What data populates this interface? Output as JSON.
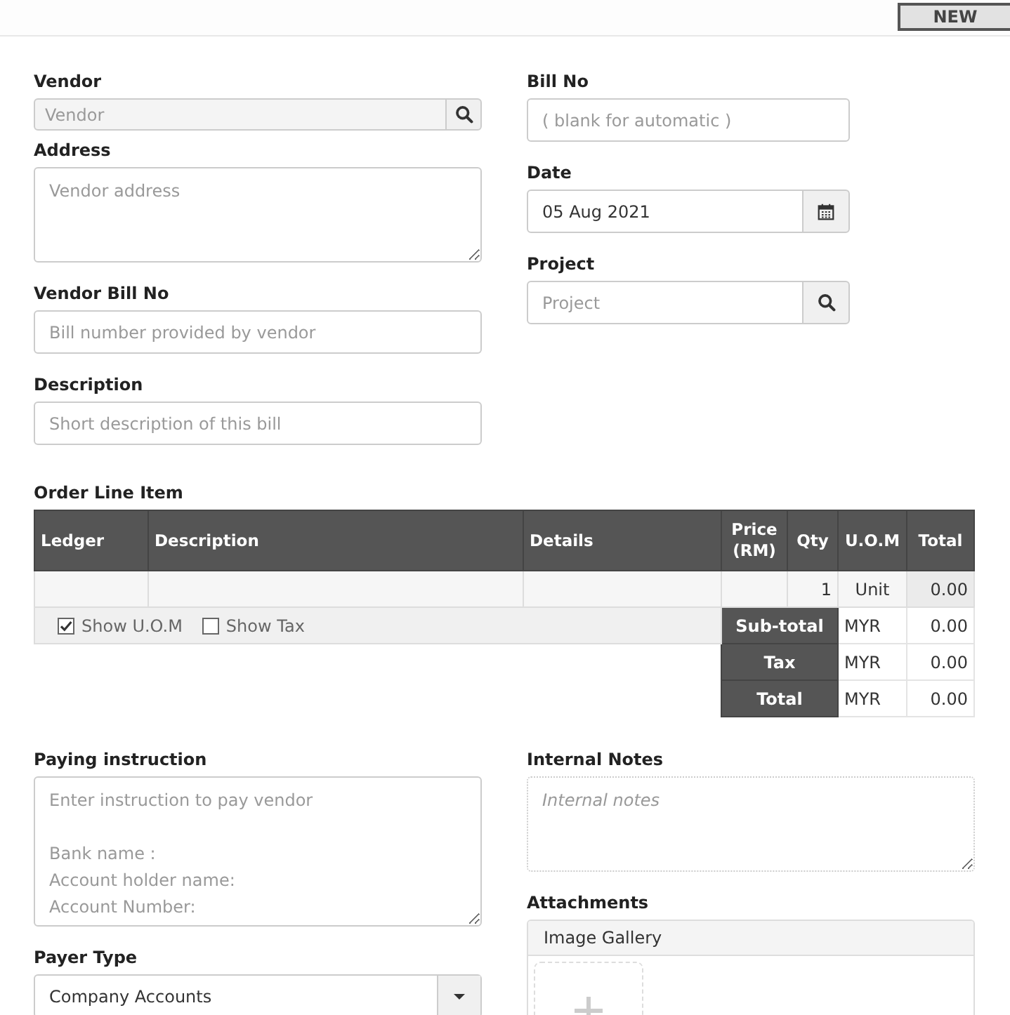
{
  "toolbar": {
    "new_button": "NEW"
  },
  "left_fields": [
    {
      "kind": "search",
      "label": "Vendor",
      "placeholder": "Vendor",
      "readonly": true
    },
    {
      "kind": "textarea",
      "label": "Address",
      "placeholder": "Vendor address"
    },
    {
      "kind": "text",
      "label": "Vendor Bill No",
      "placeholder": "Bill number provided by vendor"
    },
    {
      "kind": "text",
      "label": "Description",
      "placeholder": "Short description of this bill"
    }
  ],
  "right_fields": [
    {
      "kind": "text",
      "label": "Bill No",
      "placeholder": "( blank for automatic )"
    },
    {
      "kind": "date",
      "label": "Date",
      "value": "05 Aug 2021"
    },
    {
      "kind": "search",
      "label": "Project",
      "placeholder": "Project",
      "readonly": false
    }
  ],
  "order_lines": {
    "title": "Order Line Item",
    "columns": [
      "Ledger",
      "Description",
      "Details",
      "Price (RM)",
      "Qty",
      "U.O.M",
      "Total"
    ],
    "rows": [
      {
        "qty": "1",
        "uom": "Unit",
        "total": "0.00"
      }
    ],
    "options": [
      {
        "label": "Show U.O.M",
        "checked": true
      },
      {
        "label": "Show Tax",
        "checked": false
      }
    ],
    "totals": [
      {
        "label": "Sub-total",
        "currency": "MYR",
        "value": "0.00"
      },
      {
        "label": "Tax",
        "currency": "MYR",
        "value": "0.00"
      },
      {
        "label": "Total",
        "currency": "MYR",
        "value": "0.00"
      }
    ]
  },
  "paying_instruction": {
    "label": "Paying instruction",
    "placeholder": "Enter instruction to pay vendor\n\nBank name :\nAccount holder name:\nAccount Number:"
  },
  "payer_type": {
    "label": "Payer Type",
    "value": "Company Accounts"
  },
  "internal_notes": {
    "label": "Internal Notes",
    "placeholder": "Internal notes"
  },
  "attachments": {
    "label": "Attachments",
    "gallery_title": "Image Gallery"
  }
}
